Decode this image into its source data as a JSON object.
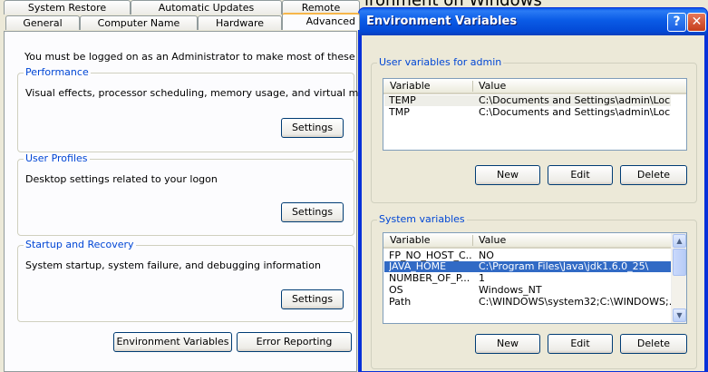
{
  "background_window": {
    "title_fragment": "ironment on Windows"
  },
  "system_properties": {
    "tabs_back": [
      "System Restore",
      "Automatic Updates",
      "Remote"
    ],
    "tabs_front": [
      "General",
      "Computer Name",
      "Hardware",
      "Advanced"
    ],
    "active_tab": "Advanced",
    "admin_note": "You must be logged on as an Administrator to make most of these changes.",
    "performance": {
      "title": "Performance",
      "desc": "Visual effects, processor scheduling, memory usage, and virtual memory",
      "button": "Settings"
    },
    "user_profiles": {
      "title": "User Profiles",
      "desc": "Desktop settings related to your logon",
      "button": "Settings"
    },
    "startup_recovery": {
      "title": "Startup and Recovery",
      "desc": "System startup, system failure, and debugging information",
      "button": "Settings"
    },
    "env_vars_button": "Environment Variables",
    "error_reporting_button": "Error Reporting"
  },
  "env_dialog": {
    "title": "Environment Variables",
    "help_glyph": "?",
    "close_glyph": "✕",
    "user_vars": {
      "title": "User variables for admin",
      "columns": [
        "Variable",
        "Value"
      ],
      "rows": [
        {
          "variable": "TEMP",
          "value": "C:\\Documents and Settings\\admin\\Local..."
        },
        {
          "variable": "TMP",
          "value": "C:\\Documents and Settings\\admin\\Local..."
        }
      ],
      "buttons": {
        "new": "New",
        "edit": "Edit",
        "delete": "Delete"
      }
    },
    "system_vars": {
      "title": "System variables",
      "columns": [
        "Variable",
        "Value"
      ],
      "rows": [
        {
          "variable": "FP_NO_HOST_C...",
          "value": "NO"
        },
        {
          "variable": "JAVA_HOME",
          "value": "C:\\Program Files\\Java\\jdk1.6.0_25\\"
        },
        {
          "variable": "NUMBER_OF_P...",
          "value": "1"
        },
        {
          "variable": "OS",
          "value": "Windows_NT"
        },
        {
          "variable": "Path",
          "value": "C:\\WINDOWS\\system32;C:\\WINDOWS;..."
        }
      ],
      "selected_row": "JAVA_HOME",
      "buttons": {
        "new": "New",
        "edit": "Edit",
        "delete": "Delete"
      }
    }
  }
}
